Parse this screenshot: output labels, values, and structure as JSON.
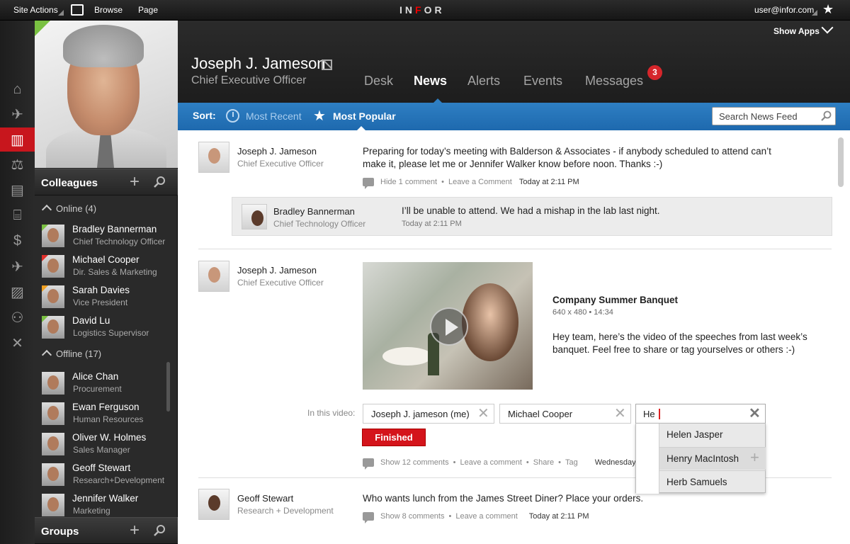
{
  "topbar": {
    "site_actions": "Site Actions",
    "browse": "Browse",
    "page": "Page",
    "logo_left": "IN",
    "logo_mid": "F",
    "logo_right": "OR",
    "user": "user@infor.com"
  },
  "header": {
    "show_apps": "Show Apps",
    "name": "Joseph J. Jameson",
    "title": "Chief Executive Officer",
    "tabs": [
      {
        "label": "Desk"
      },
      {
        "label": "News"
      },
      {
        "label": "Alerts"
      },
      {
        "label": "Events"
      },
      {
        "label": "Messages"
      }
    ],
    "messages_badge": "3"
  },
  "sortbar": {
    "label": "Sort:",
    "most_recent": "Most Recent",
    "most_popular": "Most Popular",
    "search_placeholder": "Search News Feed"
  },
  "sidebar": {
    "colleagues_title": "Colleagues",
    "online_label": "Online (4)",
    "offline_label": "Offline (17)",
    "groups_title": "Groups",
    "online": [
      {
        "name": "Bradley Bannerman",
        "role": "Chief Technology Officer"
      },
      {
        "name": "Michael Cooper",
        "role": "Dir. Sales & Marketing"
      },
      {
        "name": "Sarah Davies",
        "role": "Vice President"
      },
      {
        "name": "David Lu",
        "role": "Logistics Supervisor"
      }
    ],
    "offline": [
      {
        "name": "Alice Chan",
        "role": "Procurement"
      },
      {
        "name": "Ewan Ferguson",
        "role": "Human Resources"
      },
      {
        "name": "Oliver W. Holmes",
        "role": "Sales Manager"
      },
      {
        "name": "Geoff Stewart",
        "role": "Research+Development"
      },
      {
        "name": "Jennifer Walker",
        "role": "Marketing"
      }
    ]
  },
  "feed": {
    "posts": [
      {
        "name": "Joseph J. Jameson",
        "role": "Chief Executive Officer",
        "text_line1": "Preparing for today’s meeting with Balderson & Associates - if anybody scheduled to attend can’t",
        "text_line2": "make it, please let me or Jennifer Walker know before noon. Thanks :-)",
        "actions": [
          "Hide 1 comment",
          "Leave a Comment"
        ],
        "time": "Today at 2:11 PM",
        "reply": {
          "name": "Bradley Bannerman",
          "role": "Chief Technology Officer",
          "text": "I’ll be unable to attend. We had a mishap in the lab last night.",
          "time": "Today at 2:11 PM"
        }
      },
      {
        "name": "Joseph J. Jameson",
        "role": "Chief Executive Officer",
        "video_title": "Company Summer Banquet",
        "video_meta": "640 x 480  •  14:34",
        "text_line1": "Hey team, here’s the video of the speeches from last week’s",
        "text_line2": "banquet. Feel free to share or tag yourselves or others :-)",
        "in_this_video": "In this video:",
        "tags": [
          "Joseph J. jameson (me)",
          "Michael Cooper"
        ],
        "tag_input": "He",
        "finished": "Finished",
        "actions": [
          "Show 12 comments",
          "Leave a comment",
          "Share",
          "Tag"
        ],
        "time": "Wednesday",
        "suggestions": [
          "Helen Jasper",
          "Henry MacIntosh",
          "Herb Samuels"
        ]
      },
      {
        "name": "Geoff Stewart",
        "role": "Research + Development",
        "text": "Who wants lunch from the James Street Diner? Place your orders.",
        "actions": [
          "Show 8 comments",
          "Leave a comment"
        ],
        "time": "Today at 2:11 PM"
      }
    ]
  }
}
